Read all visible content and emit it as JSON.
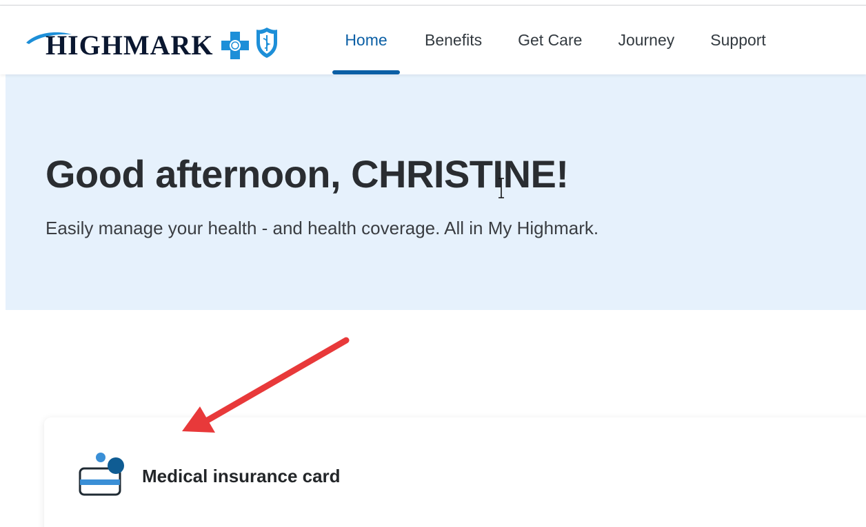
{
  "header": {
    "logo_text": "HIGHMARK",
    "nav": [
      {
        "label": "Home",
        "active": true
      },
      {
        "label": "Benefits",
        "active": false
      },
      {
        "label": "Get Care",
        "active": false
      },
      {
        "label": "Journey",
        "active": false
      },
      {
        "label": "Support",
        "active": false
      }
    ]
  },
  "hero": {
    "greeting": "Good afternoon, CHRISTINE!",
    "subtitle": "Easily manage your health - and health coverage. All in My Highmark."
  },
  "card": {
    "icon": "insurance-card-icon",
    "label": "Medical insurance card"
  },
  "overlay": {
    "annotation": "red-arrow"
  },
  "colors": {
    "brand_blue": "#0b5fa5",
    "hero_bg": "#e6f1fc",
    "arrow_red": "#e8393a",
    "icon_blue": "#0f5c93",
    "icon_light_blue": "#3a8fd6"
  }
}
